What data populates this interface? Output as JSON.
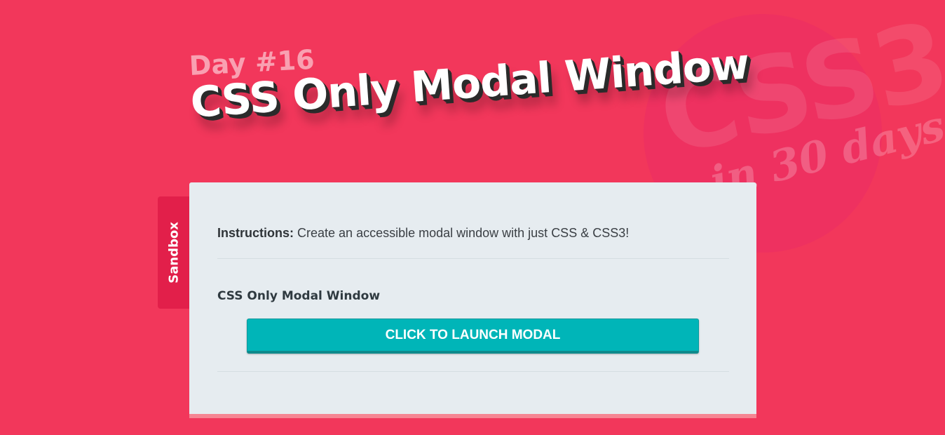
{
  "badge": {
    "big_text": "CSS3",
    "small_text": "in 30 days"
  },
  "header": {
    "day_label": "Day #16",
    "title": "CSS Only Modal Window"
  },
  "sidebar_tab": {
    "label": "Sandbox"
  },
  "panel": {
    "instructions_label": "Instructions:",
    "instructions_text": " Create an accessible modal window with just CSS & CSS3!",
    "subtitle": "CSS Only Modal Window",
    "launch_button_label": "CLICK TO LAUNCH MODAL"
  },
  "colors": {
    "background": "#f2375b",
    "panel": "#e6ecf0",
    "button": "#00b5b8",
    "sandbox_tab": "#e21f4a"
  }
}
